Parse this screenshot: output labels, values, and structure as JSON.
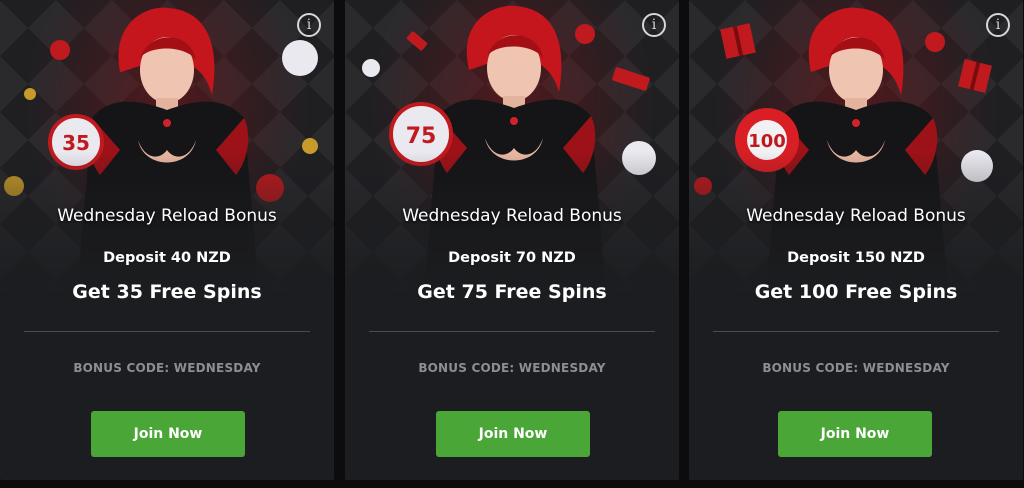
{
  "colors": {
    "card_bg": "#1c1d20",
    "page_bg": "#0c0c0e",
    "accent_green": "#49a637",
    "muted_text": "#8d8e92",
    "art_red": "#c01a1f"
  },
  "cards": [
    {
      "title": "Wednesday Reload Bonus",
      "deposit": "Deposit 40 NZD",
      "spins": "Get 35 Free Spins",
      "bonus_code": "BONUS CODE: WEDNESDAY",
      "cta": "Join Now",
      "ball_label": "35",
      "info_icon": "i"
    },
    {
      "title": "Wednesday Reload Bonus",
      "deposit": "Deposit 70 NZD",
      "spins": "Get 75 Free Spins",
      "bonus_code": "BONUS CODE: WEDNESDAY",
      "cta": "Join Now",
      "ball_label": "75",
      "info_icon": "i"
    },
    {
      "title": "Wednesday Reload Bonus",
      "deposit": "Deposit 150 NZD",
      "spins": "Get 100 Free Spins",
      "bonus_code": "BONUS CODE: WEDNESDAY",
      "cta": "Join Now",
      "ball_label": "100",
      "info_icon": "i"
    }
  ]
}
